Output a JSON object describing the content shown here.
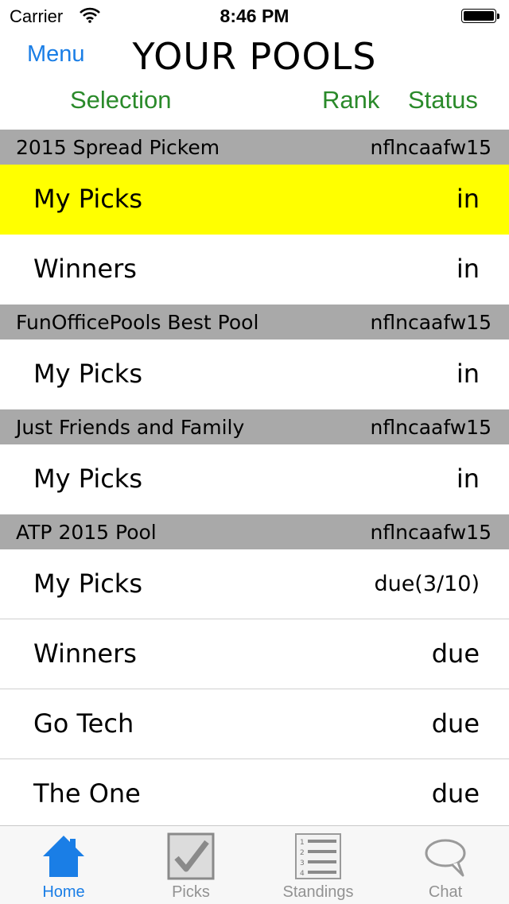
{
  "status_bar": {
    "carrier": "Carrier",
    "time": "8:46 PM"
  },
  "nav": {
    "menu_label": "Menu",
    "title": "YOUR POOLS"
  },
  "columns": {
    "selection": "Selection",
    "rank": "Rank",
    "status": "Status"
  },
  "pools": [
    {
      "name": "2015 Spread Pickem",
      "code": "nflncaafw15",
      "rows": [
        {
          "label": "My Picks",
          "status": "in",
          "highlighted": true
        },
        {
          "label": "Winners",
          "status": "in"
        }
      ]
    },
    {
      "name": "FunOfficePools Best Pool",
      "code": "nflncaafw15",
      "rows": [
        {
          "label": "My Picks",
          "status": "in"
        }
      ]
    },
    {
      "name": "Just Friends and Family",
      "code": "nflncaafw15",
      "rows": [
        {
          "label": "My Picks",
          "status": "in"
        }
      ]
    },
    {
      "name": "ATP 2015 Pool",
      "code": "nflncaafw15",
      "rows": [
        {
          "label": "My Picks",
          "status": "due(3/10)"
        },
        {
          "label": "Winners",
          "status": "due"
        },
        {
          "label": "Go Tech",
          "status": "due"
        },
        {
          "label": "The One",
          "status": "due"
        }
      ]
    }
  ],
  "tabs": [
    {
      "label": "Home",
      "icon": "home-icon",
      "active": true
    },
    {
      "label": "Picks",
      "icon": "checkbox-icon"
    },
    {
      "label": "Standings",
      "icon": "list-icon"
    },
    {
      "label": "Chat",
      "icon": "chat-bubble-icon"
    }
  ],
  "colors": {
    "accent_blue": "#1a7ee6",
    "header_green": "#2a8a2a",
    "highlight": "#ffff00",
    "section_gray": "#a9a9a9"
  }
}
